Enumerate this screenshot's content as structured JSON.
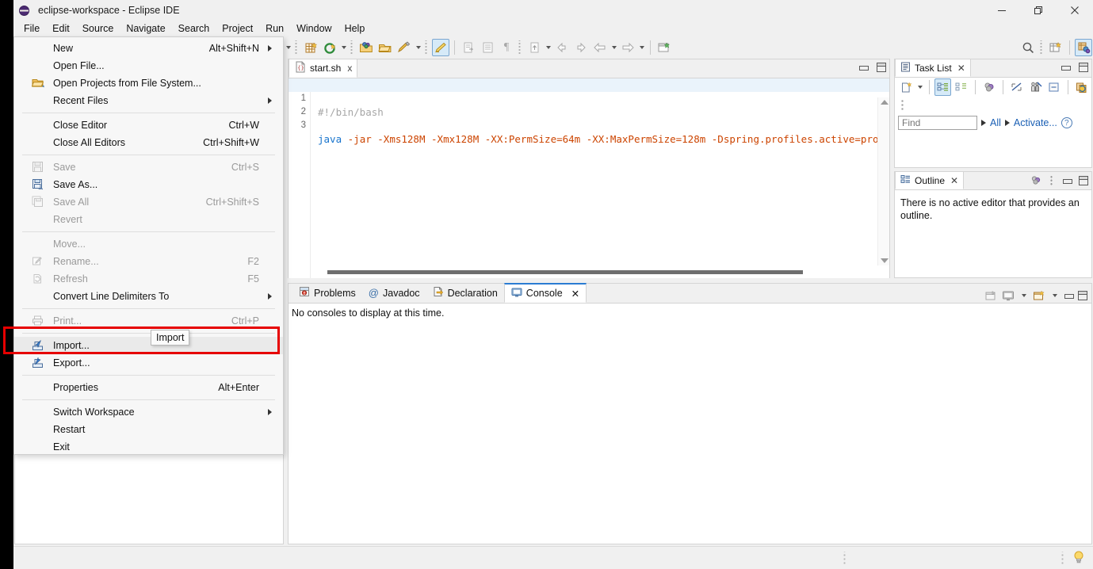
{
  "window": {
    "title": "eclipse-workspace - Eclipse IDE",
    "app_icon": "eclipse-globe-icon",
    "controls": {
      "minimize": "minimize-button",
      "maximize": "maximize-button",
      "close": "close-button"
    }
  },
  "menubar": {
    "items": [
      {
        "label": "File",
        "active": true
      },
      {
        "label": "Edit",
        "active": false
      },
      {
        "label": "Source",
        "active": false
      },
      {
        "label": "Navigate",
        "active": false
      },
      {
        "label": "Search",
        "active": false
      },
      {
        "label": "Project",
        "active": false
      },
      {
        "label": "Run",
        "active": false
      },
      {
        "label": "Window",
        "active": false
      },
      {
        "label": "Help",
        "active": false
      }
    ]
  },
  "file_menu": {
    "items": [
      {
        "label": "New",
        "accel": "Alt+Shift+N",
        "submenu": true,
        "disabled": false,
        "icon": ""
      },
      {
        "label": "Open File...",
        "accel": "",
        "submenu": false,
        "disabled": false,
        "icon": ""
      },
      {
        "label": "Open Projects from File System...",
        "accel": "",
        "submenu": false,
        "disabled": false,
        "icon": "folder-open-icon"
      },
      {
        "label": "Recent Files",
        "accel": "",
        "submenu": true,
        "disabled": false,
        "icon": ""
      },
      {
        "separator": true
      },
      {
        "label": "Close Editor",
        "accel": "Ctrl+W",
        "submenu": false,
        "disabled": false,
        "icon": ""
      },
      {
        "label": "Close All Editors",
        "accel": "Ctrl+Shift+W",
        "submenu": false,
        "disabled": false,
        "icon": ""
      },
      {
        "separator": true
      },
      {
        "label": "Save",
        "accel": "Ctrl+S",
        "submenu": false,
        "disabled": true,
        "icon": "save-icon"
      },
      {
        "label": "Save As...",
        "accel": "",
        "submenu": false,
        "disabled": false,
        "icon": "save-as-icon"
      },
      {
        "label": "Save All",
        "accel": "Ctrl+Shift+S",
        "submenu": false,
        "disabled": true,
        "icon": "save-all-icon"
      },
      {
        "label": "Revert",
        "accel": "",
        "submenu": false,
        "disabled": true,
        "icon": ""
      },
      {
        "separator": true
      },
      {
        "label": "Move...",
        "accel": "",
        "submenu": false,
        "disabled": true,
        "icon": ""
      },
      {
        "label": "Rename...",
        "accel": "F2",
        "submenu": false,
        "disabled": true,
        "icon": "rename-icon"
      },
      {
        "label": "Refresh",
        "accel": "F5",
        "submenu": false,
        "disabled": true,
        "icon": "refresh-icon"
      },
      {
        "label": "Convert Line Delimiters To",
        "accel": "",
        "submenu": true,
        "disabled": false,
        "icon": ""
      },
      {
        "separator": true
      },
      {
        "label": "Print...",
        "accel": "Ctrl+P",
        "submenu": false,
        "disabled": true,
        "icon": "print-icon"
      },
      {
        "separator": true
      },
      {
        "label": "Import...",
        "accel": "",
        "submenu": false,
        "disabled": false,
        "icon": "import-icon",
        "highlighted": true
      },
      {
        "label": "Export...",
        "accel": "",
        "submenu": false,
        "disabled": false,
        "icon": "export-icon"
      },
      {
        "separator": true
      },
      {
        "label": "Properties",
        "accel": "Alt+Enter",
        "submenu": false,
        "disabled": false,
        "icon": ""
      },
      {
        "separator": true
      },
      {
        "label": "Switch Workspace",
        "accel": "",
        "submenu": true,
        "disabled": false,
        "icon": ""
      },
      {
        "label": "Restart",
        "accel": "",
        "submenu": false,
        "disabled": false,
        "icon": ""
      },
      {
        "label": "Exit",
        "accel": "",
        "submenu": false,
        "disabled": false,
        "icon": ""
      }
    ]
  },
  "tooltip": {
    "text": "Import"
  },
  "highlight": {
    "color": "#e60000",
    "target": "Import..."
  },
  "editor": {
    "tab": {
      "label": "start.sh",
      "icon": "script-file-icon",
      "close": "x"
    },
    "lines": [
      {
        "num": "1",
        "text": "#!/bin/bash",
        "kind": "comment",
        "current": true
      },
      {
        "num": "2",
        "text": "",
        "kind": "plain",
        "current": false
      },
      {
        "num": "3",
        "text": "java -jar -Xms128M -Xmx128M -XX:PermSize=64m -XX:MaxPermSize=128m -Dspring.profiles.active=prod tar",
        "kind": "code",
        "current": false
      }
    ]
  },
  "task_list": {
    "title": "Task List",
    "icon": "tasklist-icon",
    "find_placeholder": "Find",
    "find_value": "",
    "all_label": "All",
    "activate_label": "Activate...",
    "help_icon": "question-icon",
    "toolbar_icons": [
      "new-task-icon",
      "dropdown-caret",
      "categorized-icon",
      "scheduled-icon",
      "focus-icon",
      "collapse-icon",
      "person-icon",
      "restore-icon",
      "synchronize-icon",
      "view-menu-icon"
    ]
  },
  "outline": {
    "title": "Outline",
    "icon": "outline-icon",
    "message": "There is no active editor that provides an outline."
  },
  "bottom_panel": {
    "tabs": [
      {
        "label": "Problems",
        "icon": "problems-icon",
        "active": false
      },
      {
        "label": "Javadoc",
        "icon": "javadoc-icon",
        "active": false
      },
      {
        "label": "Declaration",
        "icon": "declaration-icon",
        "active": false
      },
      {
        "label": "Console",
        "icon": "console-icon",
        "active": true
      }
    ],
    "message": "No consoles to display at this time.",
    "toolbar_icons": [
      "terminate-icon",
      "display-console-icon",
      "dropdown-caret",
      "open-console-icon",
      "dropdown-caret",
      "minimize-icon",
      "maximize-icon"
    ]
  },
  "toolbar": {
    "groups": [
      {
        "icons": [
          "new-wizard-icon",
          "dropdown-caret"
        ]
      },
      {
        "icons": [
          "new-project-icon",
          "run-last-icon",
          "dropdown-caret"
        ]
      },
      {
        "icons": [
          "open-perspective-icon",
          "open-folder-icon",
          "paint-icon",
          "dropdown-caret"
        ]
      },
      {
        "icons": [
          "marker-pen-icon"
        ]
      },
      {
        "icons": [
          "next-annotation-icon",
          "block-selection-icon",
          "pilcrow-icon"
        ]
      },
      {
        "icons": [
          "back-icon",
          "dropdown-caret",
          "forward-up-icon",
          "dropdown-caret",
          "prev-edit-icon",
          "next-edit-icon",
          "back-nav-icon",
          "dropdown-caret",
          "forward-nav-icon",
          "dropdown-caret"
        ]
      },
      {
        "icons": [
          "new-window-icon"
        ]
      }
    ],
    "right_icons": [
      "search-icon",
      "open-perspective-button",
      "java-perspective-icon"
    ]
  },
  "status_bar": {
    "left_text": "",
    "right_icon": "lightbulb-icon"
  }
}
